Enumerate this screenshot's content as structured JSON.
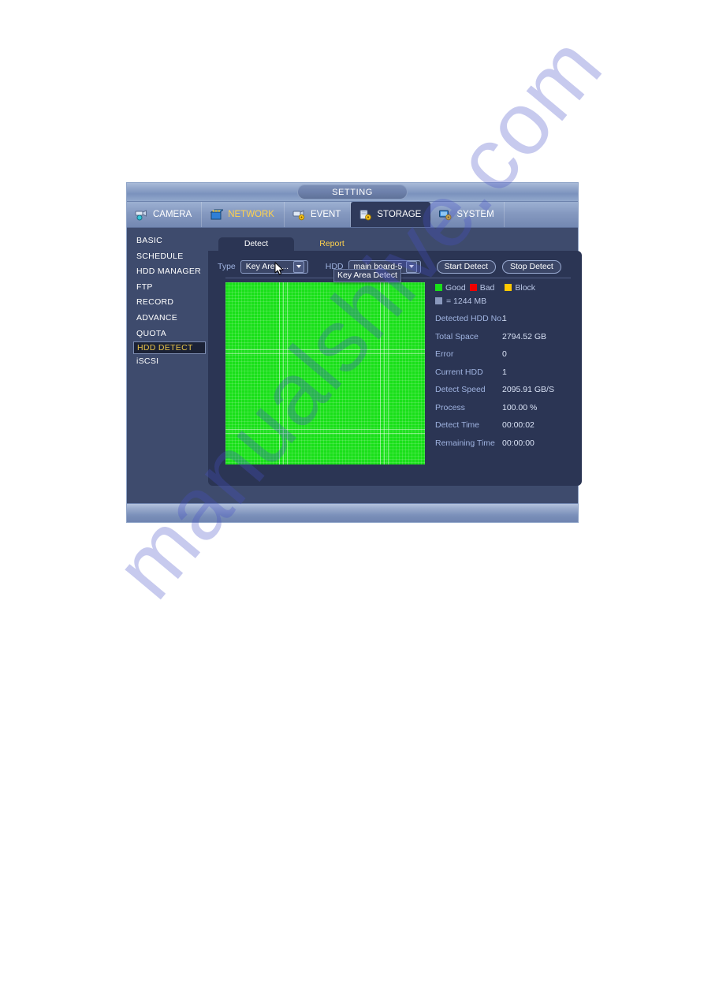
{
  "window": {
    "title": "SETTING"
  },
  "nav_tabs": [
    {
      "label": "CAMERA",
      "icon": "camera-icon",
      "state": "normal"
    },
    {
      "label": "NETWORK",
      "icon": "network-icon",
      "state": "highlight"
    },
    {
      "label": "EVENT",
      "icon": "event-icon",
      "state": "normal"
    },
    {
      "label": "STORAGE",
      "icon": "storage-icon",
      "state": "active"
    },
    {
      "label": "SYSTEM",
      "icon": "system-icon",
      "state": "normal"
    }
  ],
  "sidebar": {
    "items": [
      {
        "label": "BASIC",
        "active": false
      },
      {
        "label": "SCHEDULE",
        "active": false
      },
      {
        "label": "HDD MANAGER",
        "active": false
      },
      {
        "label": "FTP",
        "active": false
      },
      {
        "label": "RECORD",
        "active": false
      },
      {
        "label": "ADVANCE",
        "active": false
      },
      {
        "label": "QUOTA",
        "active": false
      },
      {
        "label": "HDD DETECT",
        "active": true
      },
      {
        "label": "iSCSI",
        "active": false
      }
    ]
  },
  "subtabs": [
    {
      "label": "Detect",
      "active": true
    },
    {
      "label": "Report",
      "active": false
    }
  ],
  "toolbar": {
    "type_label": "Type",
    "type_value": "Key Area ...",
    "type_tooltip": "Key Area Detect",
    "hdd_label": "HDD",
    "hdd_value": "main board-5",
    "start_button": "Start Detect",
    "stop_button": "Stop Detect"
  },
  "legend": {
    "good_label": "Good",
    "bad_label": "Bad",
    "block_label": "Block",
    "unit_label": "= 1244 MB",
    "good_color": "#19e019",
    "bad_color": "#ee0000",
    "block_color": "#ffc800",
    "unit_color": "#8a99bd"
  },
  "info": [
    {
      "key": "Detected HDD No.",
      "value": "1"
    },
    {
      "key": "Total Space",
      "value": "2794.52 GB"
    },
    {
      "key": "Error",
      "value": "0"
    },
    {
      "key": "Current HDD",
      "value": "1"
    },
    {
      "key": "Detect Speed",
      "value": "2095.91 GB/S"
    },
    {
      "key": "Process",
      "value": "100.00 %"
    },
    {
      "key": "Detect Time",
      "value": "00:00:02"
    },
    {
      "key": "Remaining Time",
      "value": "00:00:00"
    }
  ],
  "watermark": {
    "text": "manualshive.com"
  },
  "theme": {
    "accent_gold": "#ffd24d",
    "panel_bg": "#2b3554",
    "window_bg": "#3e4b6d",
    "label_blue": "#9fb3e0"
  }
}
